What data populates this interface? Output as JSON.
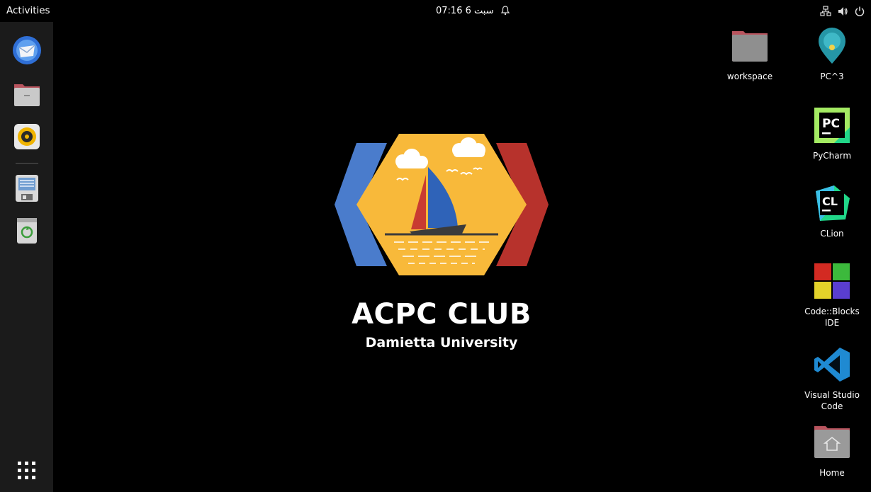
{
  "topbar": {
    "activities": "Activities",
    "clock": "سبت 6  07:16",
    "icons": [
      "notification-bell-icon",
      "network-icon",
      "volume-icon",
      "power-icon"
    ]
  },
  "dock": {
    "items": [
      {
        "name": "thunderbird-mail",
        "icon": "mail-icon"
      },
      {
        "name": "files",
        "icon": "folder-icon"
      },
      {
        "name": "rhythmbox",
        "icon": "speaker-icon"
      },
      {
        "name": "text-editor",
        "icon": "document-icon"
      },
      {
        "name": "trash",
        "icon": "trash-icon"
      }
    ],
    "show_apps_icon": "apps-grid-icon"
  },
  "wallpaper": {
    "title": "ACPC CLUB",
    "subtitle": "Damietta University",
    "colors": {
      "blue": "#4a7ccc",
      "red": "#b7322c",
      "yellow": "#f8b93a"
    }
  },
  "desktop_icons": {
    "workspace": "workspace",
    "pc3": "PC^3",
    "pycharm": "PyCharm",
    "clion": "CLion",
    "codeblocks": "Code::Blocks IDE",
    "vscode": "Visual Studio Code",
    "home": "Home"
  }
}
